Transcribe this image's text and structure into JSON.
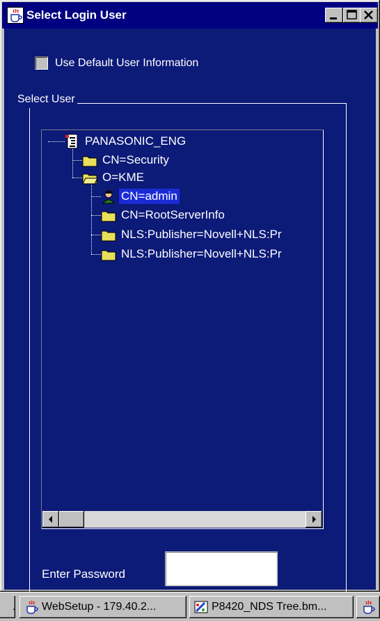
{
  "window": {
    "title": "Select Login User",
    "icon": "java-cup-icon",
    "buttons": [
      "minimize",
      "maximize",
      "close"
    ]
  },
  "default_user_checkbox": {
    "label": "Use Default User Information",
    "checked": false
  },
  "select_user_group": {
    "label": "Select User"
  },
  "tree": {
    "root": {
      "label": "PANASONIC_ENG",
      "icon": "directory-tree-icon"
    },
    "nodes": [
      {
        "label": "CN=Security",
        "icon": "folder-icon"
      },
      {
        "label": "O=KME",
        "icon": "folder-open-icon"
      },
      {
        "label": "CN=admin",
        "icon": "user-icon",
        "selected": true
      },
      {
        "label": "CN=RootServerInfo",
        "icon": "folder-icon"
      },
      {
        "label": "NLS:Publisher=Novell+NLS:Pr",
        "icon": "folder-icon"
      },
      {
        "label": "NLS:Publisher=Novell+NLS:Pr",
        "icon": "folder-icon"
      }
    ]
  },
  "password": {
    "label": "Enter Password",
    "value": ""
  },
  "taskbar": {
    "stub_label": ".",
    "items": [
      {
        "label": "WebSetup - 179.40.2...",
        "icon": "java-cup-icon"
      },
      {
        "label": "P8420_NDS Tree.bm...",
        "icon": "paint-icon"
      },
      {
        "label": "",
        "icon": "java-cup-icon"
      }
    ]
  },
  "colors": {
    "title_bar": "#000080",
    "panel_bg": "#0c1a78",
    "selection": "#1a2bd6",
    "folder": "#e8e05a"
  }
}
